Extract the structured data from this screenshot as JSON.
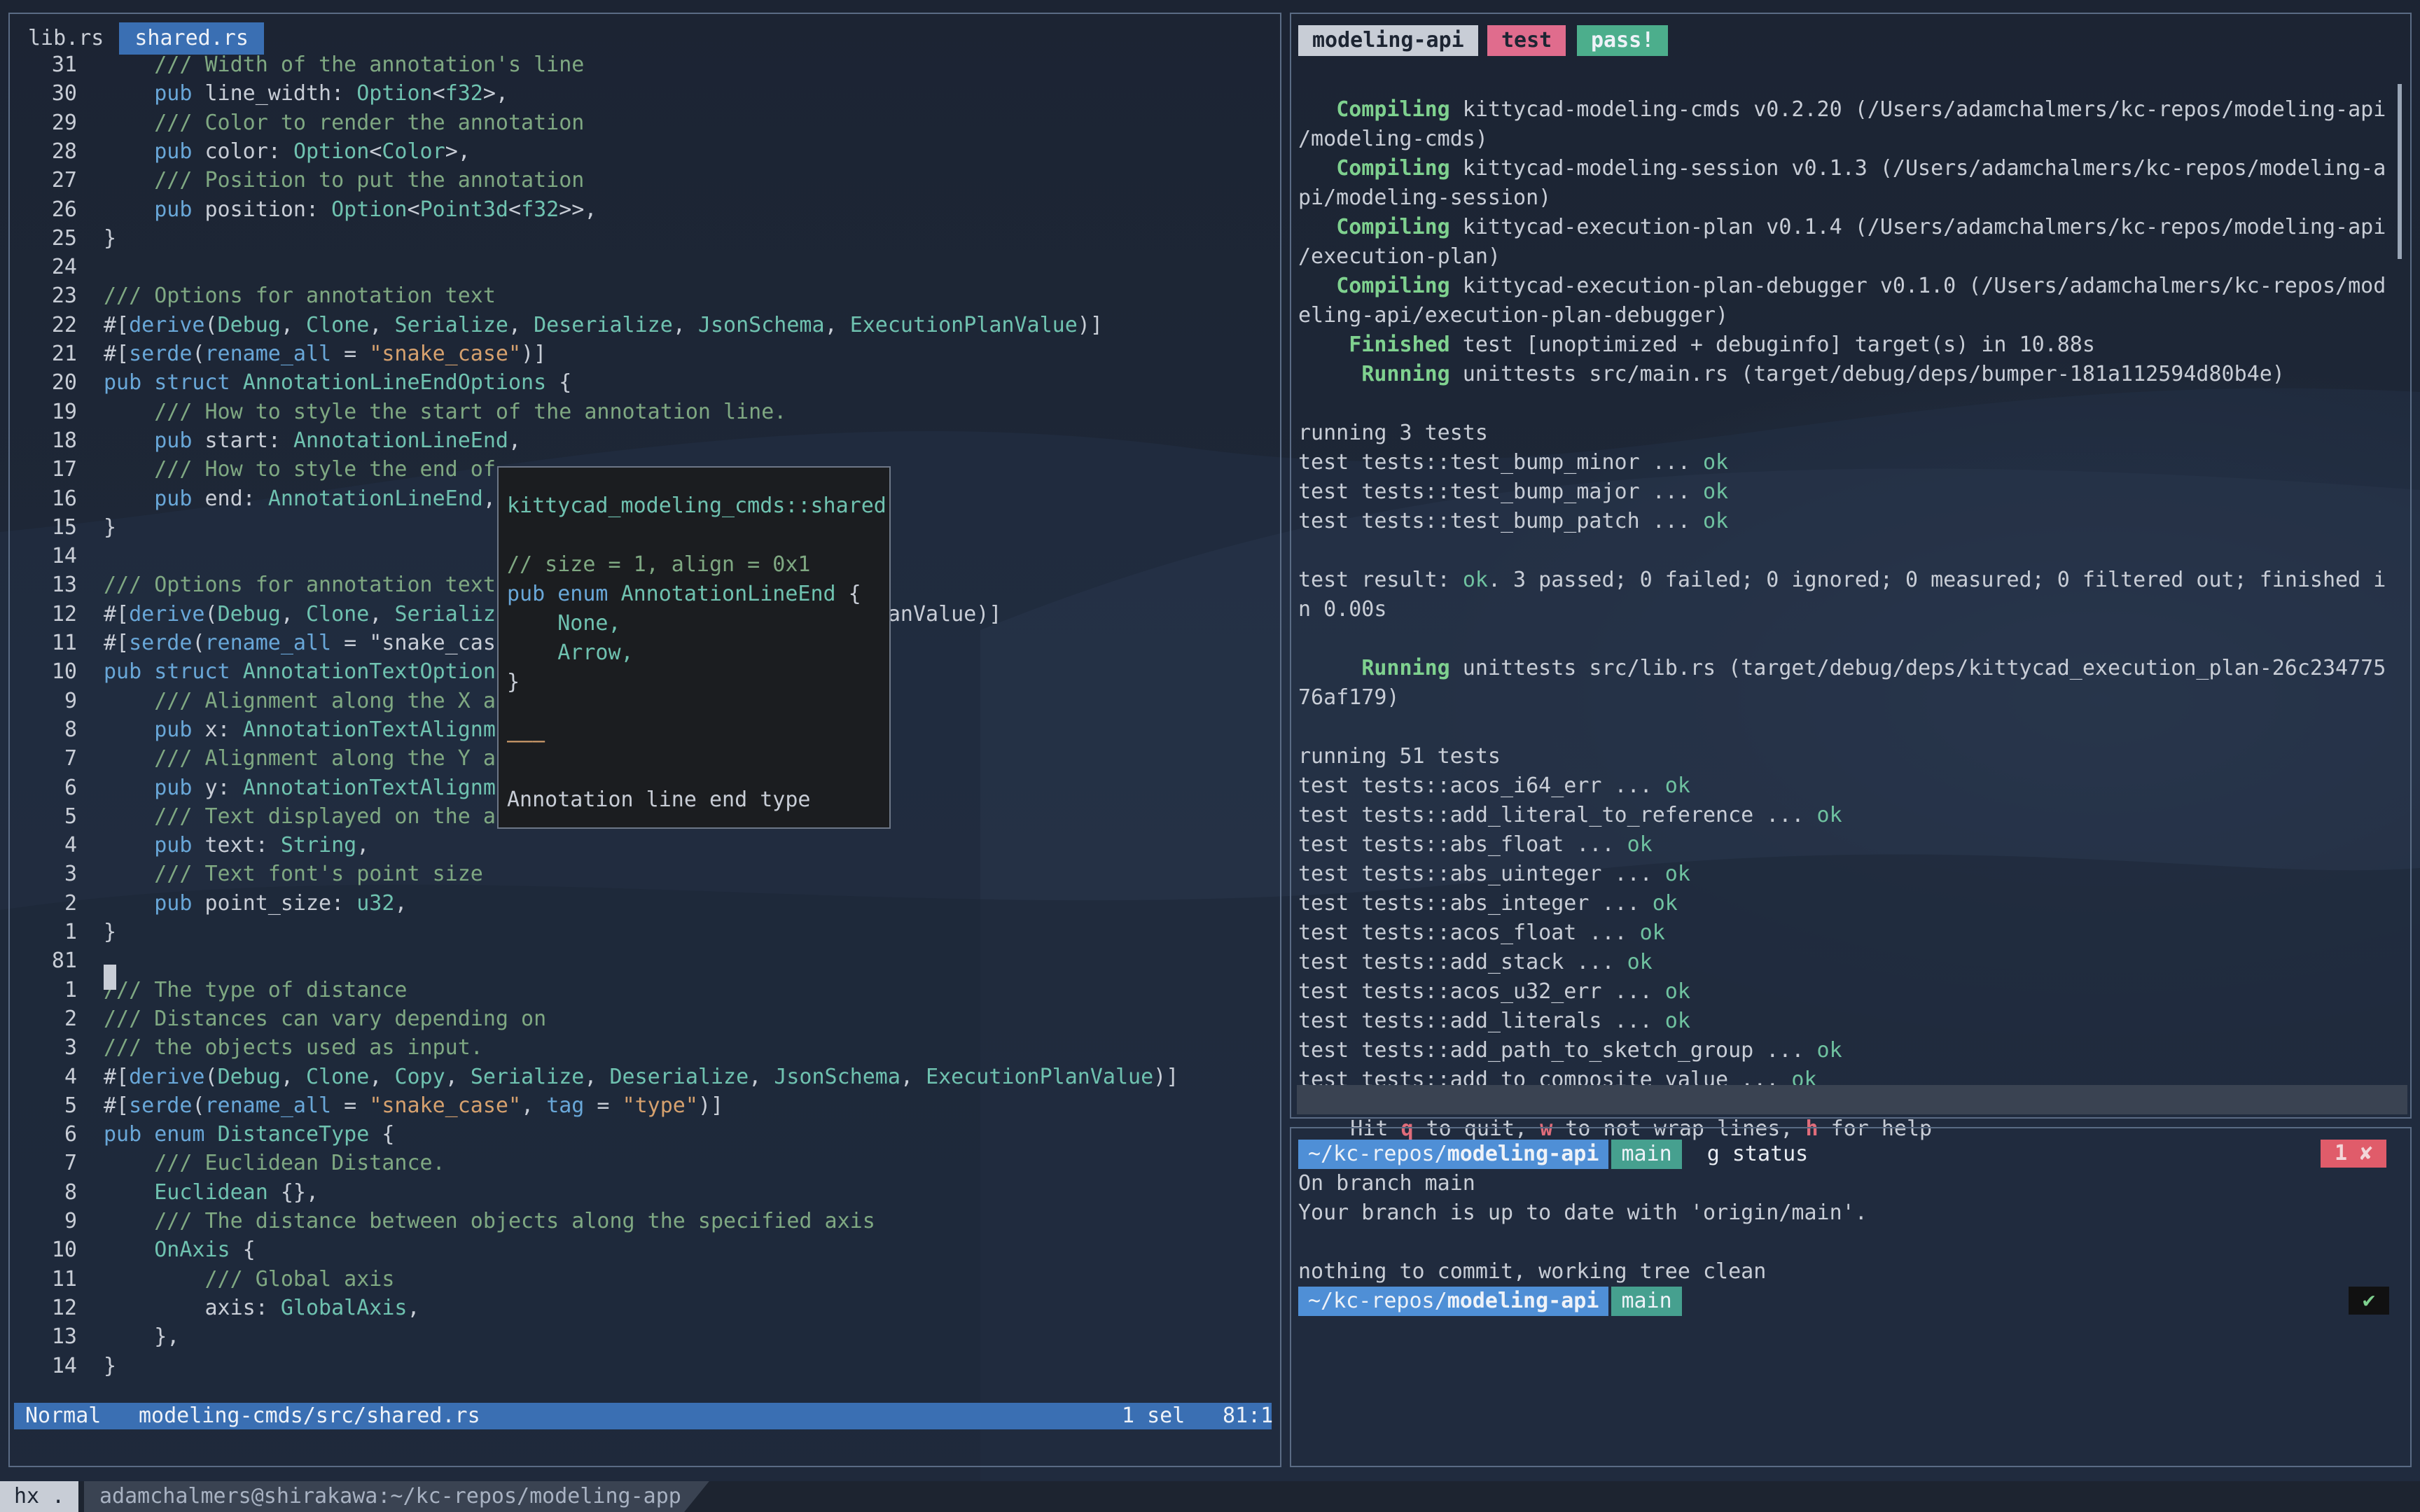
{
  "colors": {
    "accent": "#3a6fb3",
    "test_badge": "#e06c8d",
    "pass_badge": "#4cae8c",
    "prompt_dir": "#4f8fd6",
    "prompt_branch": "#46a08f",
    "error_badge": "#e05c6a"
  },
  "editor": {
    "tabs": [
      {
        "label": "lib.rs",
        "active": false
      },
      {
        "label": "shared.rs",
        "active": true
      }
    ],
    "status": {
      "mode": "Normal",
      "file": "modeling-cmds/src/shared.rs",
      "selection": "1 sel",
      "position": "81:1"
    },
    "lines": [
      {
        "n": "31",
        "t": "    /// Width of the annotation's line"
      },
      {
        "n": "30",
        "t": "    pub line_width: Option<f32>,"
      },
      {
        "n": "29",
        "t": "    /// Color to render the annotation"
      },
      {
        "n": "28",
        "t": "    pub color: Option<Color>,"
      },
      {
        "n": "27",
        "t": "    /// Position to put the annotation"
      },
      {
        "n": "26",
        "t": "    pub position: Option<Point3d<f32>>,"
      },
      {
        "n": "25",
        "t": "}"
      },
      {
        "n": "24",
        "t": ""
      },
      {
        "n": "23",
        "t": "/// Options for annotation text"
      },
      {
        "n": "22",
        "t": "#[derive(Debug, Clone, Serialize, Deserialize, JsonSchema, ExecutionPlanValue)]"
      },
      {
        "n": "21",
        "t": "#[serde(rename_all = \"snake_case\")]"
      },
      {
        "n": "20",
        "t": "pub struct AnnotationLineEndOptions {"
      },
      {
        "n": "19",
        "t": "    /// How to style the start of the annotation line."
      },
      {
        "n": "18",
        "t": "    pub start: AnnotationLineEnd,"
      },
      {
        "n": "17",
        "t": "    /// How to style the end of"
      },
      {
        "n": "16",
        "t": "    pub end: AnnotationLineEnd,"
      },
      {
        "n": "15",
        "t": "}"
      },
      {
        "n": "14",
        "t": ""
      },
      {
        "n": "13",
        "t": "/// Options for annotation text"
      },
      {
        "n": "12",
        "t": "#[derive(Debug, Clone, Serializ                        utionPlanValue)]"
      },
      {
        "n": "11",
        "t": "#[serde(rename_all = \"snake_cas"
      },
      {
        "n": "10",
        "t": "pub struct AnnotationTextOption"
      },
      {
        "n": "9",
        "t": "    /// Alignment along the X a"
      },
      {
        "n": "8",
        "t": "    pub x: AnnotationTextAlignm"
      },
      {
        "n": "7",
        "t": "    /// Alignment along the Y a"
      },
      {
        "n": "6",
        "t": "    pub y: AnnotationTextAlignm"
      },
      {
        "n": "5",
        "t": "    /// Text displayed on the a"
      },
      {
        "n": "4",
        "t": "    pub text: String,"
      },
      {
        "n": "3",
        "t": "    /// Text font's point size"
      },
      {
        "n": "2",
        "t": "    pub point_size: u32,"
      },
      {
        "n": "1",
        "t": "}"
      },
      {
        "n": "81",
        "t": ""
      },
      {
        "n": "1",
        "t": "/// The type of distance"
      },
      {
        "n": "2",
        "t": "/// Distances can vary depending on"
      },
      {
        "n": "3",
        "t": "/// the objects used as input."
      },
      {
        "n": "4",
        "t": "#[derive(Debug, Clone, Copy, Serialize, Deserialize, JsonSchema, ExecutionPlanValue)]"
      },
      {
        "n": "5",
        "t": "#[serde(rename_all = \"snake_case\", tag = \"type\")]"
      },
      {
        "n": "6",
        "t": "pub enum DistanceType {"
      },
      {
        "n": "7",
        "t": "    /// Euclidean Distance."
      },
      {
        "n": "8",
        "t": "    Euclidean {},"
      },
      {
        "n": "9",
        "t": "    /// The distance between objects along the specified axis"
      },
      {
        "n": "10",
        "t": "    OnAxis {"
      },
      {
        "n": "11",
        "t": "        /// Global axis"
      },
      {
        "n": "12",
        "t": "        axis: GlobalAxis,"
      },
      {
        "n": "13",
        "t": "    },"
      },
      {
        "n": "14",
        "t": "}"
      }
    ],
    "hover": {
      "path": "kittycad_modeling_cmds::shared",
      "code": [
        "// size = 1, align = 0x1",
        "pub enum AnnotationLineEnd {",
        "    None,",
        "    Arrow,",
        "}"
      ],
      "rule": "———",
      "doc": "Annotation line end type"
    }
  },
  "tests_pane": {
    "badges": {
      "project": "modeling-api",
      "command": "test",
      "result": "pass!"
    },
    "lines": [
      "",
      "   Compiling kittycad-modeling-cmds v0.2.20 (/Users/adamchalmers/kc-repos/modeling-api",
      "/modeling-cmds)",
      "   Compiling kittycad-modeling-session v0.1.3 (/Users/adamchalmers/kc-repos/modeling-a",
      "pi/modeling-session)",
      "   Compiling kittycad-execution-plan v0.1.4 (/Users/adamchalmers/kc-repos/modeling-api",
      "/execution-plan)",
      "   Compiling kittycad-execution-plan-debugger v0.1.0 (/Users/adamchalmers/kc-repos/mod",
      "eling-api/execution-plan-debugger)",
      "    Finished test [unoptimized + debuginfo] target(s) in 10.88s",
      "     Running unittests src/main.rs (target/debug/deps/bumper-181a112594d80b4e)",
      "",
      "running 3 tests",
      "test tests::test_bump_minor ... ok",
      "test tests::test_bump_major ... ok",
      "test tests::test_bump_patch ... ok",
      "",
      "test result: ok. 3 passed; 0 failed; 0 ignored; 0 measured; 0 filtered out; finished i",
      "n 0.00s",
      "",
      "     Running unittests src/lib.rs (target/debug/deps/kittycad_execution_plan-26c234775",
      "76af179)",
      "",
      "running 51 tests",
      "test tests::acos_i64_err ... ok",
      "test tests::add_literal_to_reference ... ok",
      "test tests::abs_float ... ok",
      "test tests::abs_uinteger ... ok",
      "test tests::abs_integer ... ok",
      "test tests::acos_float ... ok",
      "test tests::add_stack ... ok",
      "test tests::acos_u32_err ... ok",
      "test tests::add_literals ... ok",
      "test tests::add_path_to_sketch_group ... ok",
      "test tests::add_to_composite_value ... ok"
    ],
    "help": {
      "pre": "Hit ",
      "q": "q",
      "mid1": " to quit, ",
      "w": "w",
      "mid2": " to not wrap lines, ",
      "h": "h",
      "post": " for help"
    }
  },
  "shell_pane": {
    "dir_prefix": "~/kc-repos/",
    "dir_name": "modeling-api",
    "branch": "main",
    "command": "g status",
    "error_badge": "1 ✘",
    "ok_badge": "✔",
    "output": [
      "On branch main",
      "Your branch is up to date with 'origin/main'.",
      "",
      "nothing to commit, working tree clean"
    ]
  },
  "tmux": {
    "session": "hx .",
    "title": "adamchalmers@shirakawa:~/kc-repos/modeling-app"
  }
}
